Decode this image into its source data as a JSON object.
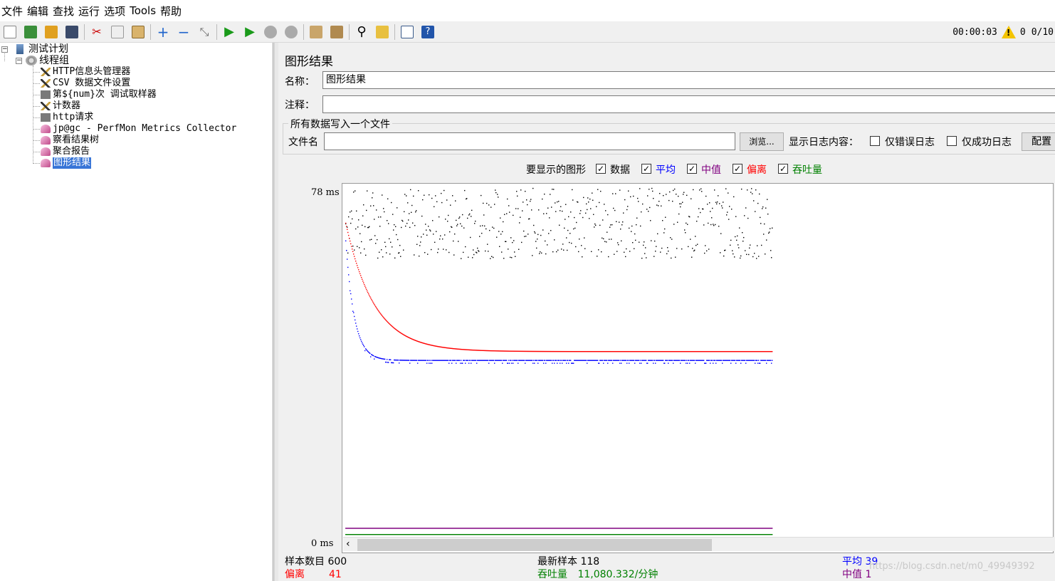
{
  "menu": [
    "文件",
    "编辑",
    "查找",
    "运行",
    "选项",
    "Tools",
    "帮助"
  ],
  "toolbar_icons": [
    "new-icon",
    "templates-icon",
    "open-icon",
    "save-icon",
    "cut-icon",
    "copy-icon",
    "paste-icon",
    "expand-icon",
    "collapse-icon",
    "toggle-icon",
    "start-icon",
    "start-no-pause-icon",
    "stop-icon",
    "shutdown-icon",
    "clear-icon",
    "clear-all-icon",
    "search-icon",
    "reset-search-icon",
    "function-helper-icon",
    "help-icon"
  ],
  "status": {
    "timer": "00:00:03",
    "warnings": "0",
    "threads": "0/10"
  },
  "tree": {
    "root": "测试计划",
    "group": "线程组",
    "items": [
      {
        "label": "HTTP信息头管理器",
        "icon": "config-icon"
      },
      {
        "label": "CSV 数据文件设置",
        "icon": "config-icon"
      },
      {
        "label": "第${num}次 调试取样器",
        "icon": "sampler-icon"
      },
      {
        "label": "计数器",
        "icon": "config-icon"
      },
      {
        "label": "http请求",
        "icon": "sampler-icon"
      },
      {
        "label": "jp@gc - PerfMon Metrics Collector",
        "icon": "listener-icon"
      },
      {
        "label": "察看结果树",
        "icon": "listener-icon"
      },
      {
        "label": "聚合报告",
        "icon": "listener-icon"
      },
      {
        "label": "图形结果",
        "icon": "listener-icon",
        "selected": true
      }
    ]
  },
  "panel": {
    "title": "图形结果",
    "name_label": "名称：",
    "name_value": "图形结果",
    "comment_label": "注释：",
    "comment_value": "",
    "file_group_title": "所有数据写入一个文件",
    "file_label": "文件名",
    "file_value": "",
    "browse_label": "浏览...",
    "log_label": "显示日志内容：",
    "errors_only_label": "仅错误日志",
    "success_only_label": "仅成功日志",
    "config_label": "配置",
    "graphs_label": "要显示的图形",
    "options": [
      {
        "label": "数据",
        "color": "#000000",
        "checked": true
      },
      {
        "label": "平均",
        "color": "#0000ff",
        "checked": true
      },
      {
        "label": "中值",
        "color": "#800080",
        "checked": true
      },
      {
        "label": "偏离",
        "color": "#ff0000",
        "checked": true
      },
      {
        "label": "吞吐量",
        "color": "#008000",
        "checked": true
      }
    ]
  },
  "chart_data": {
    "type": "scatter",
    "y_max_label": "78 ms",
    "y_min_label": "0 ms",
    "ylim": [
      0,
      78
    ],
    "x": [
      1,
      600
    ],
    "series": [
      {
        "name": "数据",
        "color": "#000000",
        "description": "individual sample times scattered between ~50 and 78 ms"
      },
      {
        "name": "平均",
        "color": "#0000ff",
        "values_start": 66,
        "values_end": 39
      },
      {
        "name": "中值",
        "color": "#800080",
        "values_start": 1,
        "values_end": 1
      },
      {
        "name": "偏离",
        "color": "#ff0000",
        "values_start": 70,
        "values_end": 41
      },
      {
        "name": "吞吐量",
        "color": "#008000",
        "values_start": 0,
        "values_end": 0
      }
    ]
  },
  "stats": {
    "samples_label": "样本数目",
    "samples_value": "600",
    "latest_label": "最新样本",
    "latest_value": "118",
    "avg_label": "平均",
    "avg_value": "39",
    "dev_label": "偏离",
    "dev_value": "41",
    "throughput_label": "吞吐量",
    "throughput_value": "11,080.332/分钟",
    "median_label": "中值",
    "median_value": "1"
  },
  "watermark": "https://blog.csdn.net/m0_49949392"
}
